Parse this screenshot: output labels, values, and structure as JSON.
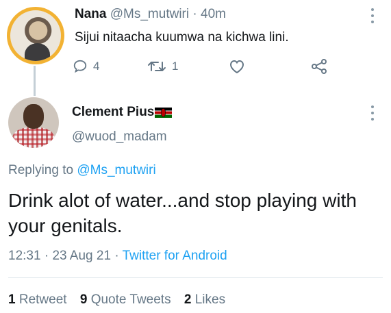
{
  "parent_tweet": {
    "name": "Nana",
    "handle": "@Ms_mutwiri",
    "separator": "·",
    "time": "40m",
    "text": "Sijui nitaacha kuumwa na kichwa lini.",
    "replies": "4",
    "retweets": "1",
    "icons": {
      "reply": "comment-icon",
      "retweet": "retweet-icon",
      "like": "heart-icon",
      "share": "share-icon",
      "more": "more-vertical-icon"
    }
  },
  "reply_tweet": {
    "name": "Clement Pius",
    "flag": "kenya-flag-icon",
    "handle": "@wuod_madam",
    "replying_prefix": "Replying to ",
    "replying_to": "@Ms_mutwiri",
    "text": "Drink alot of water...and stop playing with your genitals.",
    "time": "12:31",
    "date": "23 Aug 21",
    "dot": "·",
    "source": "Twitter for Android",
    "stats": {
      "retweets_count": "1",
      "retweets_label": "Retweet",
      "quotes_count": "9",
      "quotes_label": "Quote Tweets",
      "likes_count": "2",
      "likes_label": "Likes"
    }
  },
  "colors": {
    "link": "#1da1f2",
    "secondary_text": "#657786",
    "primary_text": "#14171a",
    "avatar_ring": "#f2b233"
  }
}
